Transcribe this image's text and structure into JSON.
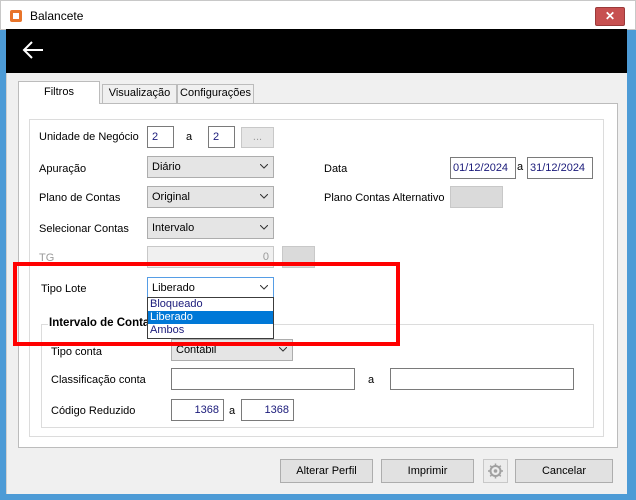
{
  "window": {
    "title": "Balancete"
  },
  "tabs": [
    "Filtros",
    "Visualização",
    "Configurações"
  ],
  "filters": {
    "unidade_negocio": {
      "label": "Unidade de Negócio",
      "from": "2",
      "sep": "a",
      "to": "2",
      "button": "..."
    },
    "apuracao": {
      "label": "Apuração",
      "value": "Diário"
    },
    "data": {
      "label": "Data",
      "from": "01/12/2024",
      "sep": "a",
      "to": "31/12/2024"
    },
    "plano_contas": {
      "label": "Plano de Contas",
      "value": "Original"
    },
    "plano_contas_alternativo": {
      "label": "Plano Contas Alternativo",
      "value": ""
    },
    "selecionar_contas": {
      "label": "Selecionar Contas",
      "value": "Intervalo"
    },
    "tg": {
      "label": "TG",
      "value": "0"
    },
    "tipo_lote": {
      "label": "Tipo Lote",
      "value": "Liberado",
      "options": [
        "Bloqueado",
        "Liberado",
        "Ambos"
      ],
      "selected": "Liberado"
    }
  },
  "intervalo": {
    "title": "Intervalo de Contas",
    "tipo_conta": {
      "label": "Tipo conta",
      "value": "Contábil"
    },
    "classificacao": {
      "label": "Classificação conta",
      "from": "",
      "sep": "a",
      "to": ""
    },
    "codigo_reduzido": {
      "label": "Código Reduzido",
      "from": "1368",
      "sep": "a",
      "to": "1368"
    }
  },
  "footer": {
    "alterar_perfil": "Alterar Perfil",
    "imprimir": "Imprimir",
    "cancelar": "Cancelar"
  },
  "colors": {
    "highlight": "#ff0000",
    "selection": "#0078d7",
    "header": "#000000"
  }
}
